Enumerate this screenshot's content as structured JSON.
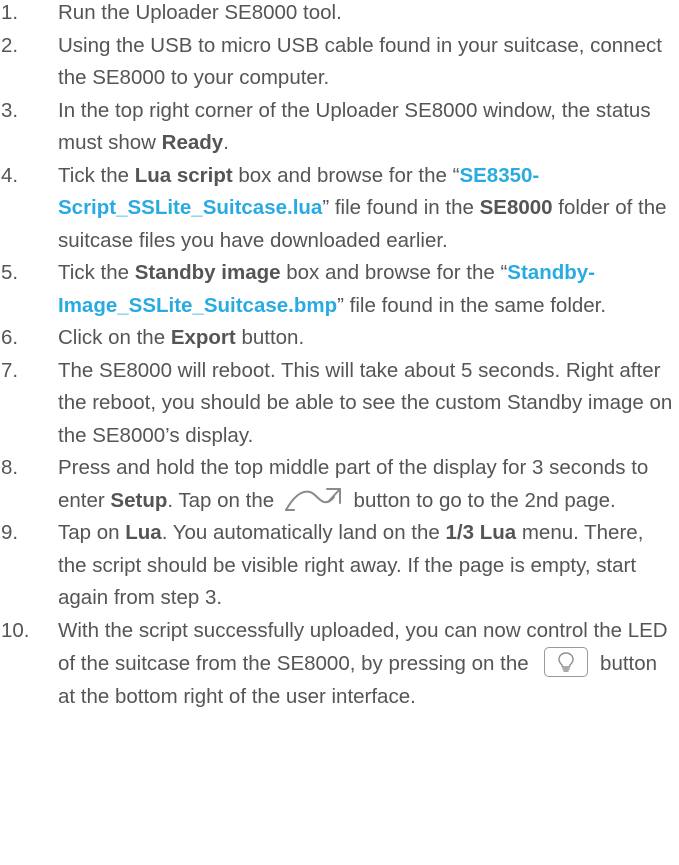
{
  "steps": [
    {
      "num": "1.",
      "parts": [
        {
          "t": "Run the Uploader SE8000 tool."
        }
      ]
    },
    {
      "num": "2.",
      "parts": [
        {
          "t": "Using the USB to micro USB cable found in your suitcase, connect the SE8000 to your computer."
        }
      ]
    },
    {
      "num": "3.",
      "parts": [
        {
          "t": "In the top right corner of the Uploader SE8000 window, the status must show "
        },
        {
          "t": "Ready",
          "s": "b"
        },
        {
          "t": "."
        }
      ]
    },
    {
      "num": "4.",
      "parts": [
        {
          "t": "Tick the "
        },
        {
          "t": "Lua script",
          "s": "b"
        },
        {
          "t": " box and browse for the “"
        },
        {
          "t": "SE8350-Script_SSLite_Suitcase.lua",
          "s": "link"
        },
        {
          "t": "” file found in the "
        },
        {
          "t": "SE8000",
          "s": "b"
        },
        {
          "t": " folder of the suitcase files you have downloaded earlier."
        }
      ]
    },
    {
      "num": "5.",
      "parts": [
        {
          "t": "Tick the "
        },
        {
          "t": "Standby image",
          "s": "b"
        },
        {
          "t": " box and browse for the “"
        },
        {
          "t": "Standby-Image_SSLite_Suitcase.bmp",
          "s": "link"
        },
        {
          "t": "” file found in the same folder."
        }
      ]
    },
    {
      "num": "6.",
      "parts": [
        {
          "t": "Click on the "
        },
        {
          "t": "Export",
          "s": "b"
        },
        {
          "t": " button."
        }
      ]
    },
    {
      "num": "7.",
      "parts": [
        {
          "t": "The SE8000 will reboot. This will take about 5 seconds. Right after the reboot, you should be able to see the custom Standby image on the SE8000’s display."
        }
      ]
    },
    {
      "num": "8.",
      "parts": [
        {
          "t": "Press and hold the top middle part of the display for 3 seconds to enter "
        },
        {
          "t": "Setup",
          "s": "b"
        },
        {
          "t": ". Tap on the "
        },
        {
          "icon": "swipe-arrow-icon"
        },
        {
          "t": " button to go to the 2nd page."
        }
      ]
    },
    {
      "num": "9.",
      "parts": [
        {
          "t": "Tap on "
        },
        {
          "t": "Lua",
          "s": "b"
        },
        {
          "t": ". You automatically land on the "
        },
        {
          "t": "1/3 Lua",
          "s": "b"
        },
        {
          "t": " menu. There, the script should be visible right away. If the page is empty, start again from step 3."
        }
      ]
    },
    {
      "num": "10.",
      "parts": [
        {
          "t": "With the script successfully uploaded, you can now control the LED of the suitcase from the SE8000, by pressing on the "
        },
        {
          "icon": "lightbulb-icon"
        },
        {
          "t": " button at the bottom right of the user interface."
        }
      ]
    }
  ],
  "colors": {
    "text": "#555555",
    "link": "#29abe2",
    "icon": "#999999"
  }
}
